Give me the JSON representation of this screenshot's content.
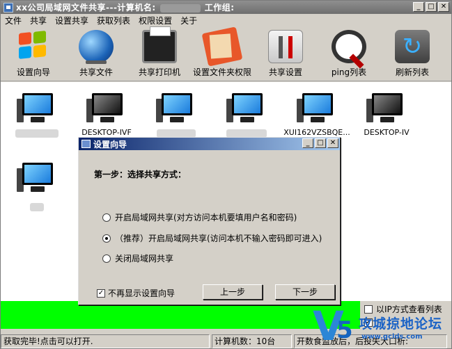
{
  "window": {
    "title_left": "xx公司局域网文件共享---计算机名:",
    "title_right": "工作组:",
    "buttons": {
      "minimize": "_",
      "maximize": "□",
      "close": "✕"
    }
  },
  "menu": [
    "文件",
    "共享",
    "设置共享",
    "获取列表",
    "权限设置",
    "关于"
  ],
  "toolbar": [
    {
      "label": "设置向导",
      "icon": "windows-flag-icon"
    },
    {
      "label": "共享文件",
      "icon": "globe-icon"
    },
    {
      "label": "共享打印机",
      "icon": "printer-icon"
    },
    {
      "label": "设置文件夹权限",
      "icon": "folder-icon"
    },
    {
      "label": "共享设置",
      "icon": "tools-icon"
    },
    {
      "label": "ping列表",
      "icon": "magnifier-icon"
    },
    {
      "label": "刷新列表",
      "icon": "refresh-icon"
    }
  ],
  "computers": [
    {
      "name": "",
      "screen": "blue"
    },
    {
      "name": "DESKTOP-IVF",
      "screen": "dark"
    },
    {
      "name": "",
      "screen": "blue"
    },
    {
      "name": "",
      "screen": "blue"
    },
    {
      "name": "XUI162VZSBQE...",
      "screen": "blue"
    },
    {
      "name": "DESKTOP-IV",
      "screen": "dark"
    },
    {
      "name": "",
      "screen": "blue"
    }
  ],
  "dialog": {
    "title": "设置向导",
    "step": "第一步：选择共享方式：",
    "options": [
      "开启局域网共享(对方访问本机要填用户名和密码)",
      "（推荐）开启局域网共享(访问本机不输入密码即可进入)",
      "关闭局域网共享"
    ],
    "selected_option": 1,
    "dont_show_label": "不再显示设置向导",
    "dont_show_checked": true,
    "prev_label": "上一步",
    "next_label": "下一步"
  },
  "side_options": {
    "ip_view_label": "以IP方式查看列表",
    "ip_view_checked": false,
    "second_label": "",
    "second_checked": true
  },
  "status": {
    "message": "获取完毕!点击可以打开.",
    "count": "计算机数：10台",
    "tip": "开数食监放后，后投失大口析:"
  },
  "watermark": {
    "mark": "V",
    "digit": "5",
    "text": "攻城掠地论坛",
    "url": "www.gclds.com"
  },
  "colors": {
    "progress": "#00ff00",
    "dialog_title_start": "#0a246a",
    "dialog_title_end": "#a6caf0"
  }
}
